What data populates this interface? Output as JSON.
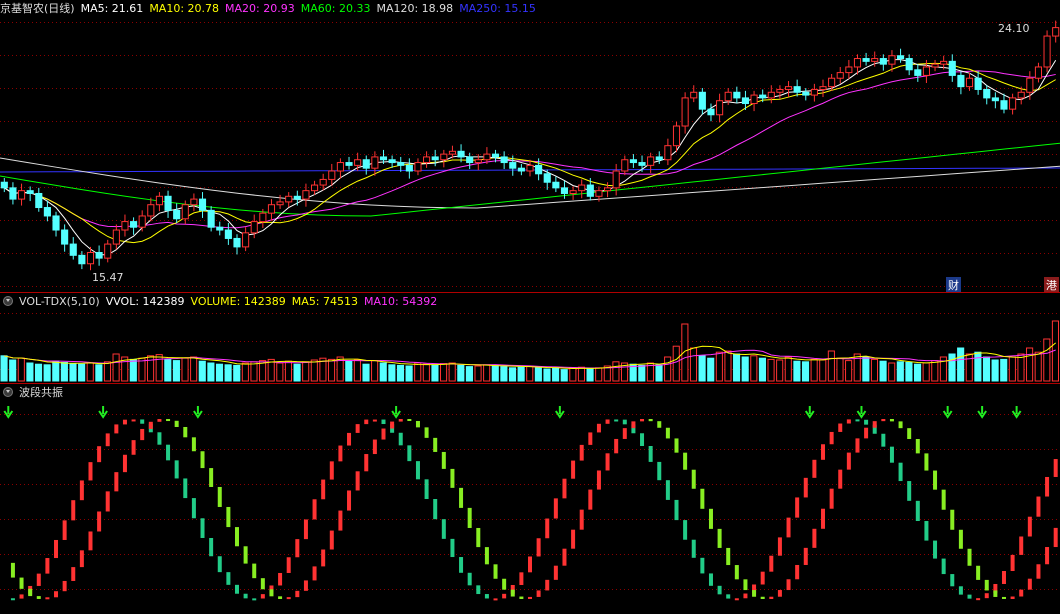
{
  "price_panel": {
    "title": "京基智农(日线)",
    "ma": [
      {
        "label": "MA5: 21.61",
        "color": "#ffffff"
      },
      {
        "label": "MA10: 20.78",
        "color": "#ffff00"
      },
      {
        "label": "MA20: 20.93",
        "color": "#ff33ff"
      },
      {
        "label": "MA60: 20.33",
        "color": "#00ff00"
      },
      {
        "label": "MA120: 18.98",
        "color": "#dddddd"
      },
      {
        "label": "MA250: 15.15",
        "color": "#3333ff"
      }
    ],
    "high_label": "24.10",
    "low_label": "15.47",
    "badge_left": "财",
    "badge_right": "港"
  },
  "volume_panel": {
    "title": "VOL-TDX(5,10)",
    "items": [
      {
        "label": "VVOL: 142389",
        "color": "#ffffff"
      },
      {
        "label": "VOLUME: 142389",
        "color": "#ffff00"
      },
      {
        "label": "MA5: 74513",
        "color": "#ffff00"
      },
      {
        "label": "MA10: 54392",
        "color": "#ff33ff"
      }
    ]
  },
  "wave_panel": {
    "title": "波段共振"
  },
  "colors": {
    "up": "#ff3333",
    "down": "#54ffff",
    "ma5": "#ffffff",
    "ma10": "#ffff00",
    "ma20": "#ff33ff",
    "ma60": "#00ff00",
    "ma120": "#dddddd",
    "ma250": "#3333ff",
    "grid": "#8b0000",
    "arrow": "#22ee22"
  },
  "chart_data": {
    "type": "candlestick",
    "high": 24.1,
    "low": 15.47,
    "closes": [
      18.4,
      18.0,
      18.3,
      18.2,
      17.7,
      17.4,
      16.9,
      16.4,
      16.0,
      15.7,
      16.1,
      15.9,
      16.4,
      16.9,
      17.2,
      17.0,
      17.4,
      17.8,
      18.1,
      17.6,
      17.3,
      17.8,
      18.0,
      17.6,
      17.0,
      16.9,
      16.6,
      16.3,
      16.8,
      17.2,
      17.5,
      17.8,
      17.9,
      18.1,
      18.0,
      18.3,
      18.5,
      18.7,
      19.0,
      19.3,
      19.2,
      19.4,
      19.1,
      19.5,
      19.4,
      19.3,
      19.2,
      19.0,
      19.3,
      19.5,
      19.4,
      19.6,
      19.7,
      19.5,
      19.3,
      19.4,
      19.6,
      19.5,
      19.3,
      19.1,
      19.0,
      19.2,
      18.9,
      18.6,
      18.4,
      18.2,
      18.3,
      18.5,
      18.1,
      18.3,
      18.4,
      19.0,
      19.4,
      19.3,
      19.2,
      19.5,
      19.4,
      19.9,
      20.6,
      21.6,
      21.8,
      21.2,
      21.0,
      21.5,
      21.8,
      21.6,
      21.4,
      21.7,
      21.6,
      21.8,
      21.9,
      22.0,
      21.8,
      21.7,
      21.9,
      22.0,
      22.3,
      22.5,
      22.7,
      23.0,
      22.9,
      23.0,
      22.8,
      23.1,
      23.0,
      22.6,
      22.4,
      22.7,
      22.8,
      22.9,
      22.4,
      22.0,
      22.3,
      21.9,
      21.6,
      21.5,
      21.2,
      21.6,
      21.8,
      22.3,
      22.7,
      23.8,
      24.1
    ],
    "volumes": [
      0.42,
      0.35,
      0.38,
      0.3,
      0.28,
      0.27,
      0.33,
      0.31,
      0.29,
      0.28,
      0.3,
      0.27,
      0.32,
      0.45,
      0.4,
      0.36,
      0.38,
      0.42,
      0.44,
      0.36,
      0.34,
      0.38,
      0.4,
      0.33,
      0.3,
      0.28,
      0.27,
      0.26,
      0.3,
      0.32,
      0.34,
      0.36,
      0.3,
      0.33,
      0.28,
      0.32,
      0.35,
      0.38,
      0.36,
      0.4,
      0.33,
      0.35,
      0.28,
      0.34,
      0.3,
      0.27,
      0.26,
      0.25,
      0.3,
      0.28,
      0.27,
      0.29,
      0.3,
      0.26,
      0.24,
      0.25,
      0.27,
      0.26,
      0.24,
      0.22,
      0.23,
      0.25,
      0.22,
      0.2,
      0.21,
      0.19,
      0.22,
      0.23,
      0.2,
      0.22,
      0.25,
      0.32,
      0.3,
      0.28,
      0.26,
      0.3,
      0.27,
      0.4,
      0.58,
      0.95,
      0.55,
      0.42,
      0.38,
      0.48,
      0.5,
      0.45,
      0.4,
      0.42,
      0.38,
      0.36,
      0.35,
      0.4,
      0.33,
      0.32,
      0.36,
      0.35,
      0.5,
      0.38,
      0.34,
      0.45,
      0.4,
      0.36,
      0.33,
      0.3,
      0.32,
      0.31,
      0.28,
      0.3,
      0.34,
      0.4,
      0.45,
      0.55,
      0.45,
      0.48,
      0.4,
      0.35,
      0.36,
      0.4,
      0.45,
      0.55,
      0.48,
      0.7,
      1.0
    ]
  }
}
